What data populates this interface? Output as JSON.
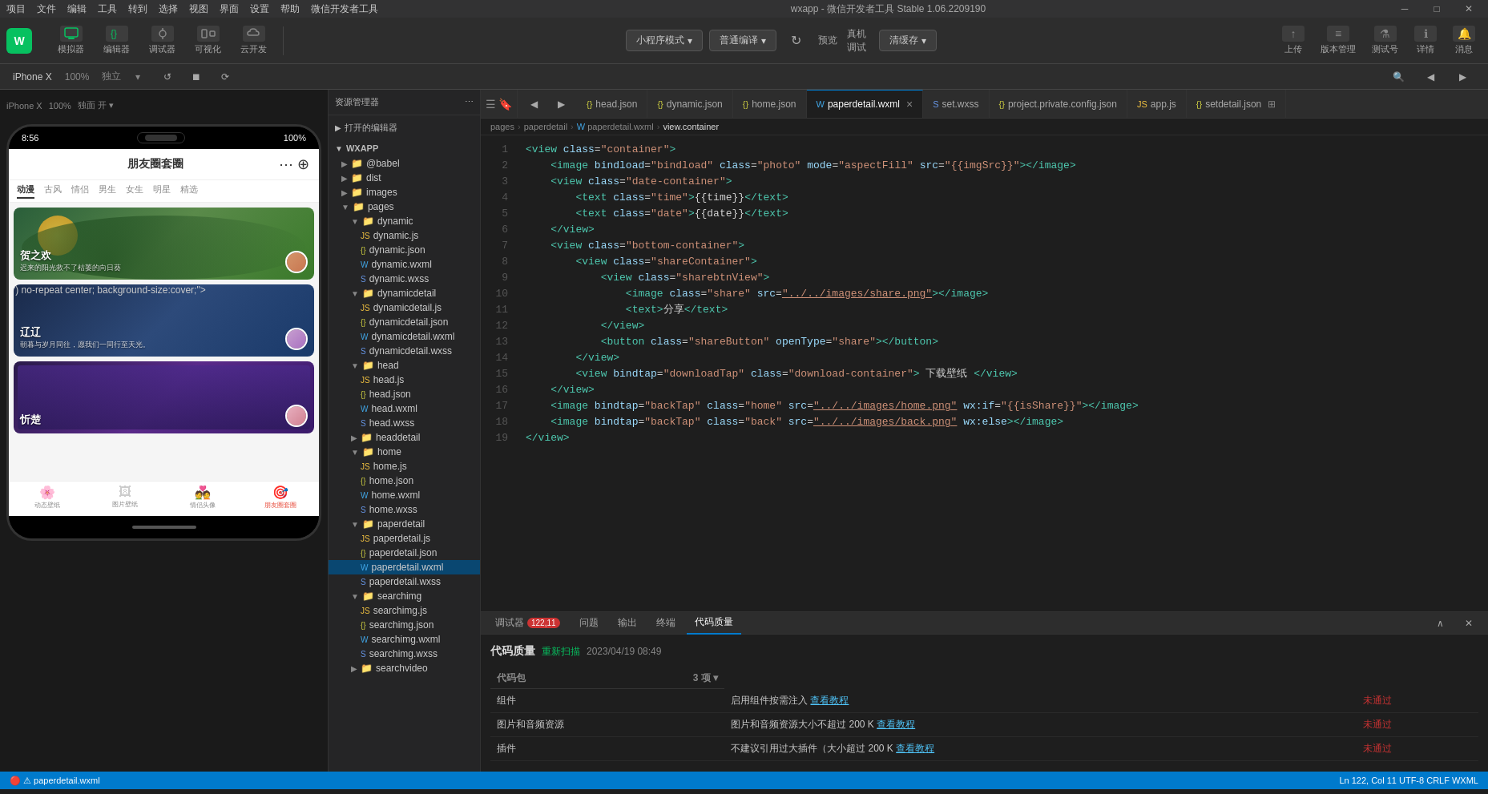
{
  "window": {
    "title": "wxapp - 微信开发者工具 Stable 1.06.2209190",
    "min_label": "─",
    "max_label": "□",
    "close_label": "✕"
  },
  "menu": {
    "items": [
      "项目",
      "文件",
      "编辑",
      "工具",
      "转到",
      "选择",
      "视图",
      "界面",
      "设置",
      "帮助",
      "微信开发者工具"
    ]
  },
  "toolbar": {
    "logo_text": "W",
    "simulator_label": "模拟器",
    "editor_label": "编辑器",
    "debug_label": "调试器",
    "visual_label": "可视化",
    "cloud_label": "云开发",
    "mode_label": "小程序模式",
    "compile_label": "普通编译",
    "compile_btn": "▾",
    "refresh_label": "↻",
    "preview_label": "预览",
    "real_label": "真机调试",
    "clean_label": "清缓存",
    "upload_label": "上传",
    "version_label": "版本管理",
    "test_label": "测试号",
    "detail_label": "详情",
    "msg_label": "消息"
  },
  "device_bar": {
    "device": "iPhone X",
    "zoom": "100%",
    "mode": "独立",
    "compile_icon": "↺",
    "stop_icon": "⏹",
    "rotate_icon": "⟳"
  },
  "file_tree": {
    "header": "资源管理器",
    "more_icon": "⋯",
    "open_editors": "打开的编辑器",
    "project": "WXAPP",
    "folders": [
      {
        "name": "@babel",
        "indent": 1,
        "type": "folder",
        "expanded": false
      },
      {
        "name": "dist",
        "indent": 1,
        "type": "folder",
        "expanded": false
      },
      {
        "name": "images",
        "indent": 1,
        "type": "folder",
        "expanded": false
      },
      {
        "name": "pages",
        "indent": 1,
        "type": "folder",
        "expanded": true
      },
      {
        "name": "dynamic",
        "indent": 2,
        "type": "folder",
        "expanded": true
      },
      {
        "name": "dynamic.js",
        "indent": 3,
        "type": "js"
      },
      {
        "name": "dynamic.json",
        "indent": 3,
        "type": "json"
      },
      {
        "name": "dynamic.wxml",
        "indent": 3,
        "type": "wxml"
      },
      {
        "name": "dynamic.wxss",
        "indent": 3,
        "type": "wxss"
      },
      {
        "name": "dynamicdetail",
        "indent": 2,
        "type": "folder",
        "expanded": true
      },
      {
        "name": "dynamicdetail.js",
        "indent": 3,
        "type": "js"
      },
      {
        "name": "dynamicdetail.json",
        "indent": 3,
        "type": "json"
      },
      {
        "name": "dynamicdetail.wxml",
        "indent": 3,
        "type": "wxml"
      },
      {
        "name": "dynamicdetail.wxss",
        "indent": 3,
        "type": "wxss"
      },
      {
        "name": "head",
        "indent": 2,
        "type": "folder",
        "expanded": true
      },
      {
        "name": "head.js",
        "indent": 3,
        "type": "js"
      },
      {
        "name": "head.json",
        "indent": 3,
        "type": "json"
      },
      {
        "name": "head.wxml",
        "indent": 3,
        "type": "wxml"
      },
      {
        "name": "head.wxss",
        "indent": 3,
        "type": "wxss"
      },
      {
        "name": "headdetail",
        "indent": 2,
        "type": "folder",
        "expanded": false
      },
      {
        "name": "home",
        "indent": 2,
        "type": "folder",
        "expanded": true
      },
      {
        "name": "home.js",
        "indent": 3,
        "type": "js"
      },
      {
        "name": "home.json",
        "indent": 3,
        "type": "json"
      },
      {
        "name": "home.wxml",
        "indent": 3,
        "type": "wxml"
      },
      {
        "name": "home.wxss",
        "indent": 3,
        "type": "wxss"
      },
      {
        "name": "paperdetail",
        "indent": 2,
        "type": "folder",
        "expanded": true
      },
      {
        "name": "paperdetail.js",
        "indent": 3,
        "type": "js"
      },
      {
        "name": "paperdetail.json",
        "indent": 3,
        "type": "json"
      },
      {
        "name": "paperdetail.wxml",
        "indent": 3,
        "type": "wxml",
        "active": true
      },
      {
        "name": "paperdetail.wxss",
        "indent": 3,
        "type": "wxss"
      },
      {
        "name": "searchimg",
        "indent": 2,
        "type": "folder",
        "expanded": true
      },
      {
        "name": "searchimg.js",
        "indent": 3,
        "type": "js"
      },
      {
        "name": "searchimg.json",
        "indent": 3,
        "type": "json"
      },
      {
        "name": "searchimg.wxml",
        "indent": 3,
        "type": "wxml"
      },
      {
        "name": "searchimg.wxss",
        "indent": 3,
        "type": "wxss"
      },
      {
        "name": "searchvideo",
        "indent": 2,
        "type": "folder",
        "expanded": false
      }
    ]
  },
  "tabs": [
    {
      "id": "head-json",
      "label": "{ } head.json",
      "type": "json",
      "active": false
    },
    {
      "id": "dynamic-json",
      "label": "{ } dynamic.json",
      "type": "json",
      "active": false
    },
    {
      "id": "home-json",
      "label": "{ } home.json",
      "type": "json",
      "active": false
    },
    {
      "id": "paperdetail-wxml",
      "label": "paperdetail.wxml",
      "type": "wxml",
      "active": true
    },
    {
      "id": "set-wxss",
      "label": "set.wxss",
      "type": "wxss",
      "active": false
    },
    {
      "id": "project-config",
      "label": "{ } project.private.config.json",
      "type": "json",
      "active": false
    },
    {
      "id": "app-js",
      "label": "app.js",
      "type": "js",
      "active": false
    },
    {
      "id": "setdetail-json",
      "label": "{ } setdetail.json",
      "type": "json",
      "active": false
    }
  ],
  "breadcrumb": {
    "items": [
      "pages",
      "paperdetail",
      "paperdetail.wxml",
      "view.container"
    ]
  },
  "code": {
    "lines": [
      {
        "num": 1,
        "content": "<view class=\"container\">",
        "tokens": [
          {
            "t": "tag",
            "v": "<view"
          },
          {
            "t": "attr",
            "v": " class"
          },
          {
            "t": "punct",
            "v": "="
          },
          {
            "t": "val",
            "v": "\"container\""
          },
          {
            "t": "tag",
            "v": ">"
          }
        ]
      },
      {
        "num": 2,
        "content": "    <image bindload=\"bindload\" class=\"photo\" mode=\"aspectFill\" src=\"{{imgSrc}}\"></image>",
        "tokens": []
      },
      {
        "num": 3,
        "content": "    <view class=\"date-container\">",
        "tokens": []
      },
      {
        "num": 4,
        "content": "        <text class=\"time\">{{time}}</text>",
        "tokens": []
      },
      {
        "num": 5,
        "content": "        <text class=\"date\">{{date}}</text>",
        "tokens": []
      },
      {
        "num": 6,
        "content": "    </view>",
        "tokens": []
      },
      {
        "num": 7,
        "content": "    <view class=\"bottom-container\">",
        "tokens": []
      },
      {
        "num": 8,
        "content": "        <view class=\"shareContainer\">",
        "tokens": []
      },
      {
        "num": 9,
        "content": "            <view class=\"sharebtnView\">",
        "tokens": []
      },
      {
        "num": 10,
        "content": "                <image class=\"share\" src=\"../../images/share.png\"></image>",
        "tokens": []
      },
      {
        "num": 11,
        "content": "                <text>分享</text>",
        "tokens": []
      },
      {
        "num": 12,
        "content": "            </view>",
        "tokens": []
      },
      {
        "num": 13,
        "content": "            <button class=\"shareButton\" openType=\"share\"></button>",
        "tokens": []
      },
      {
        "num": 14,
        "content": "        </view>",
        "tokens": []
      },
      {
        "num": 15,
        "content": "        <view bindtap=\"downloadTap\" class=\"download-container\"> 下载壁纸 </view>",
        "tokens": []
      },
      {
        "num": 16,
        "content": "    </view>",
        "tokens": []
      },
      {
        "num": 17,
        "content": "    <image bindtap=\"backTap\" class=\"home\" src=\"../../images/home.png\" wx:if=\"{{isShare}}\"></image>",
        "tokens": []
      },
      {
        "num": 18,
        "content": "    <image bindtap=\"backTap\" class=\"back\" src=\"../../images/back.png\" wx:else></image>",
        "tokens": []
      },
      {
        "num": 19,
        "content": "</view>",
        "tokens": []
      }
    ]
  },
  "bottom_panel": {
    "tabs": [
      {
        "label": "调试器",
        "badge": "122,11"
      },
      {
        "label": "问题"
      },
      {
        "label": "输出"
      },
      {
        "label": "终端"
      },
      {
        "label": "代码质量",
        "active": true
      }
    ],
    "quality": {
      "title": "代码质量",
      "rescan": "重新扫描",
      "date": "2023/04/19 08:49",
      "code_pkg_label": "代码包",
      "code_pkg_count": "3 项 ▾",
      "component_label": "组件",
      "component_desc": "启用组件按需注入",
      "component_link": "查看教程",
      "component_status": "未通过",
      "media_label": "图片和音频资源",
      "media_desc": "图片和音频资源大小不超过 200 K",
      "media_link": "查看教程",
      "media_status": "未通过",
      "plugin_label": "插件",
      "plugin_desc": "不建议引用过大插件（大小超过 200 K",
      "plugin_link": "查看教程",
      "plugin_status": "未通过"
    }
  },
  "phone": {
    "time": "8:56",
    "battery": "100%",
    "app_title": "朋友圈套圈",
    "tabs": [
      "动漫",
      "古风",
      "情侣",
      "男生",
      "女生",
      "明星",
      "精选"
    ],
    "cards": [
      {
        "name": "贺之欢",
        "desc": "迟来的阳光救不了枯萎的向日葵"
      },
      {
        "name": "辽辽",
        "desc": "朝暮与岁月同往，愿我们一同行至天光。"
      },
      {
        "name": "忻楚",
        "desc": ""
      }
    ],
    "nav_items": [
      "动态壁纸",
      "图片壁纸",
      "情侣头像",
      "朋友圈套圈"
    ]
  },
  "status_bar": {
    "left": "🔴 ⚠ paperdetail.wxml",
    "right": "Ln 122, Col 11  UTF-8  CRLF  WXML"
  }
}
